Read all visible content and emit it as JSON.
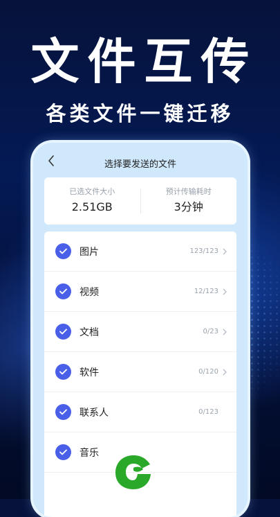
{
  "hero": {
    "title": "文件互传",
    "subtitle": "各类文件一键迁移"
  },
  "screen": {
    "nav": {
      "title": "选择要发送的文件",
      "back_icon": "chevron-left-icon"
    },
    "summary": {
      "selected_size_label": "已选文件大小",
      "selected_size_value": "2.51GB",
      "eta_label": "预计传输耗时",
      "eta_value": "3分钟"
    },
    "categories": [
      {
        "label": "图片",
        "count": "123/123",
        "checked": true,
        "chevron": true
      },
      {
        "label": "视频",
        "count": "12/123",
        "checked": true,
        "chevron": true
      },
      {
        "label": "文档",
        "count": "0/23",
        "checked": true,
        "chevron": true
      },
      {
        "label": "软件",
        "count": "0/120",
        "checked": true,
        "chevron": true
      },
      {
        "label": "联系人",
        "count": "0/123",
        "checked": true,
        "chevron": false
      },
      {
        "label": "音乐",
        "count": "",
        "checked": true,
        "chevron": false
      }
    ]
  },
  "colors": {
    "accent": "#4a5fe8",
    "screen_background": "#cfe8fb",
    "logo_green": "#2aa82a"
  }
}
